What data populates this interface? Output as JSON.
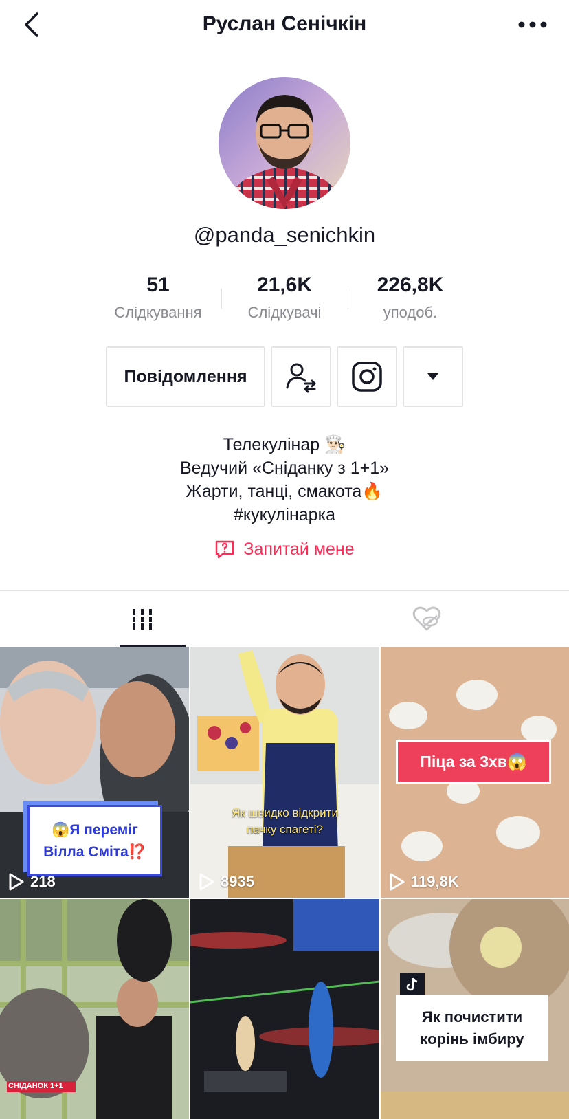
{
  "header": {
    "title": "Руслан Сенічкін"
  },
  "profile": {
    "username": "@panda_senichkin"
  },
  "stats": [
    {
      "value": "51",
      "label": "Слідкування"
    },
    {
      "value": "21,6K",
      "label": "Слідкувачі"
    },
    {
      "value": "226,8K",
      "label": "уподоб."
    }
  ],
  "actions": {
    "message_label": "Повідомлення"
  },
  "bio": {
    "line1": "Телекулінар 👨🏻‍🍳",
    "line2": "Ведучий «Сніданку з 1+1»",
    "line3": "Жарти, танці, смакота🔥",
    "line4": "#кукулінарка"
  },
  "ask": {
    "label": "Запитай мене"
  },
  "videos": [
    {
      "views": "218",
      "caption": "😱Я переміг Вілла Сміта⁉️"
    },
    {
      "views": "8935",
      "caption": "Як швидко відкрити пачку спагеті?"
    },
    {
      "views": "119,8K",
      "caption": "Піца за 3хв😱"
    },
    {
      "views": "",
      "caption": "СНІДАНОК 1+1"
    },
    {
      "views": "",
      "caption": ""
    },
    {
      "views": "",
      "caption": "Як почистити корінь імбиру"
    }
  ],
  "colors": {
    "accent": "#fe2c55",
    "text": "#161823",
    "muted": "#8a8b91",
    "border": "#e3e3e4"
  }
}
